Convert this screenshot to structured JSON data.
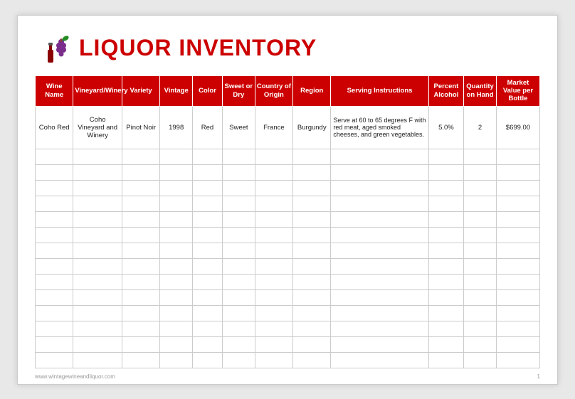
{
  "header": {
    "title": "LIQUOR INVENTORY"
  },
  "columns": [
    {
      "id": "wine_name",
      "label": "Wine Name"
    },
    {
      "id": "vineyard",
      "label": "Vineyard/Winery"
    },
    {
      "id": "variety",
      "label": "Variety"
    },
    {
      "id": "vintage",
      "label": "Vintage"
    },
    {
      "id": "color",
      "label": "Color"
    },
    {
      "id": "sweet_dry",
      "label": "Sweet or Dry"
    },
    {
      "id": "country",
      "label": "Country of Origin"
    },
    {
      "id": "region",
      "label": "Region"
    },
    {
      "id": "serving",
      "label": "Serving Instructions"
    },
    {
      "id": "percent",
      "label": "Percent Alcohol"
    },
    {
      "id": "quantity",
      "label": "Quantity on Hand"
    },
    {
      "id": "market",
      "label": "Market Value per Bottle"
    }
  ],
  "rows": [
    {
      "wine_name": "Coho Red",
      "vineyard": "Coho Vineyard and Winery",
      "variety": "Pinot Noir",
      "vintage": "1998",
      "color": "Red",
      "sweet_dry": "Sweet",
      "country": "France",
      "region": "Burgundy",
      "serving": "Serve at 60 to 65 degrees F with red meat, aged smoked cheeses, and green vegetables.",
      "percent": "5.0%",
      "quantity": "2",
      "market": "$699.00"
    }
  ],
  "empty_rows": 14,
  "footer": {
    "left": "www.wintagewineandliquor.com",
    "right": "1"
  }
}
